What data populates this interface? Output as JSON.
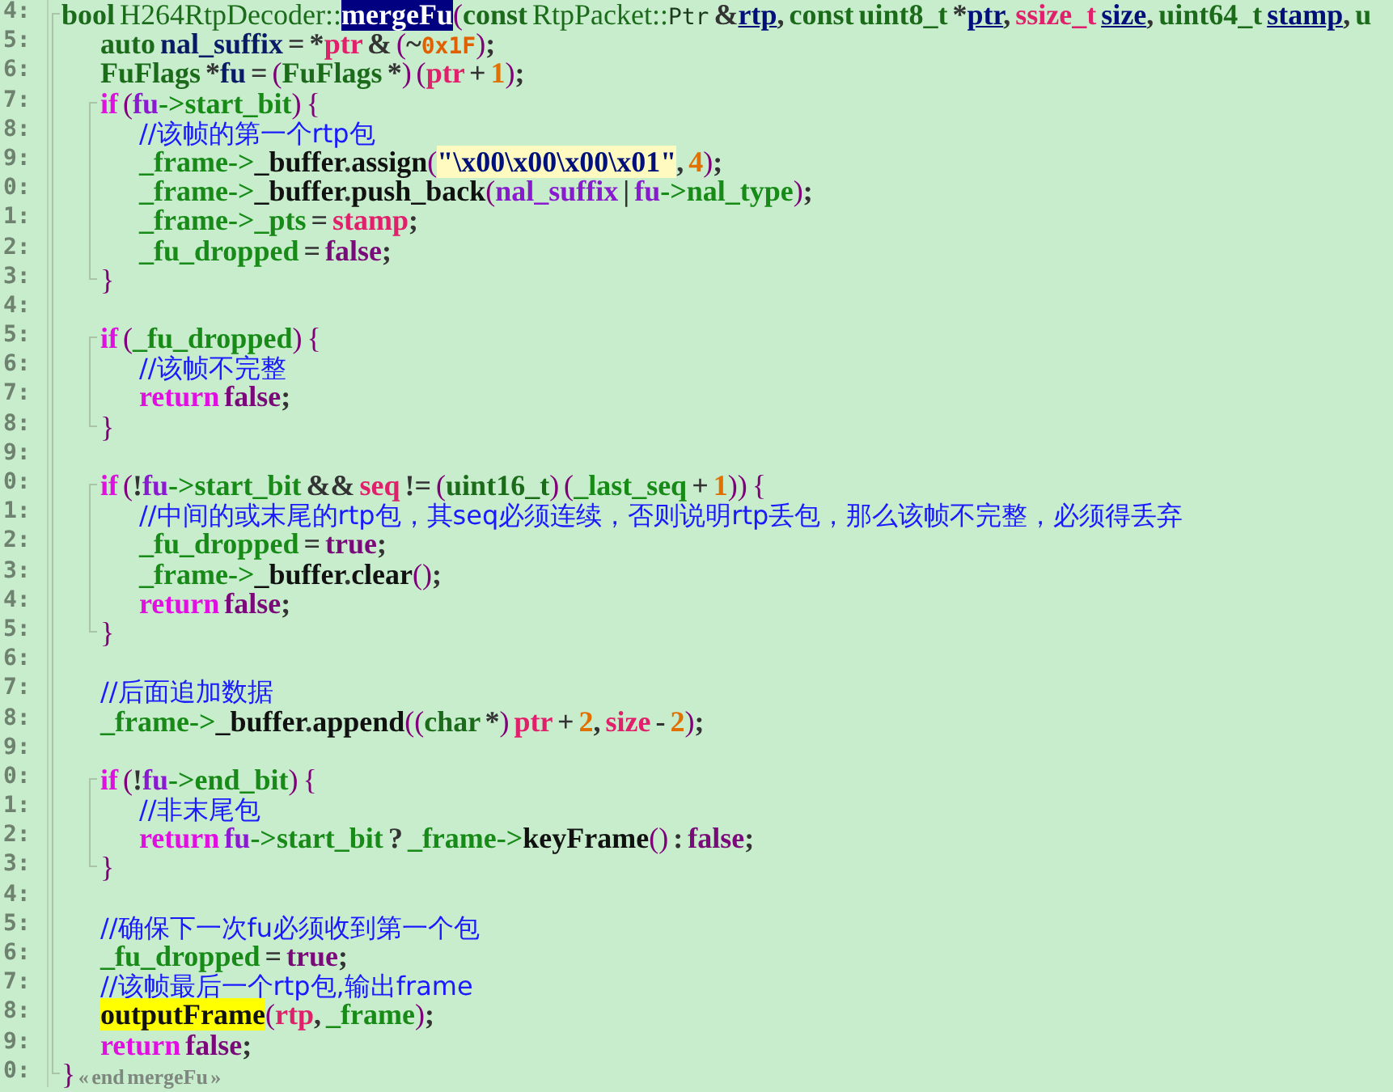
{
  "editor": {
    "lines": [
      {
        "number": "4:",
        "tokens": [
          {
            "kind": "type",
            "text": "bool"
          },
          {
            "kind": "scope",
            "text": " H264RtpDecoder::"
          },
          {
            "kind": "highlight",
            "text": "mergeFu"
          },
          {
            "kind": "punct",
            "text": "("
          },
          {
            "kind": "type",
            "text": "const"
          },
          {
            "kind": "scope",
            "text": " RtpPacket::"
          },
          {
            "kind": "mono",
            "text": "Ptr"
          },
          {
            "kind": "op",
            "text": " &"
          },
          {
            "kind": "param",
            "text": "rtp"
          },
          {
            "kind": "op",
            "text": ", "
          },
          {
            "kind": "type",
            "text": "const uint8_t"
          },
          {
            "kind": "op",
            "text": " *"
          },
          {
            "kind": "param",
            "text": "ptr"
          },
          {
            "kind": "op",
            "text": ", "
          },
          {
            "kind": "typedef",
            "text": "ssize_t "
          },
          {
            "kind": "param",
            "text": "size"
          },
          {
            "kind": "op",
            "text": ", "
          },
          {
            "kind": "type",
            "text": "uint64_t "
          },
          {
            "kind": "param",
            "text": "stamp"
          },
          {
            "kind": "op",
            "text": ", "
          },
          {
            "kind": "type",
            "text": "u"
          }
        ],
        "children": [
          {
            "number": "5:",
            "tokens": [
              {
                "kind": "type",
                "text": "auto"
              },
              {
                "kind": "local",
                "text": " nal_suffix"
              },
              {
                "kind": "op",
                "text": " = *"
              },
              {
                "kind": "arg",
                "text": "ptr"
              },
              {
                "kind": "op",
                "text": " & "
              },
              {
                "kind": "punct",
                "text": "("
              },
              {
                "kind": "op",
                "text": "~"
              },
              {
                "kind": "hex",
                "text": "0x1F"
              },
              {
                "kind": "punct",
                "text": ")"
              },
              {
                "kind": "op",
                "text": ";"
              }
            ]
          },
          {
            "number": "6:",
            "tokens": [
              {
                "kind": "type",
                "text": "FuFlags"
              },
              {
                "kind": "op",
                "text": " *"
              },
              {
                "kind": "local",
                "text": "fu"
              },
              {
                "kind": "op",
                "text": " = "
              },
              {
                "kind": "punct",
                "text": "("
              },
              {
                "kind": "type",
                "text": "FuFlags"
              },
              {
                "kind": "op",
                "text": " *"
              },
              {
                "kind": "punct",
                "text": ") ("
              },
              {
                "kind": "arg",
                "text": "ptr"
              },
              {
                "kind": "op",
                "text": " + "
              },
              {
                "kind": "num",
                "text": "1"
              },
              {
                "kind": "punct",
                "text": ")"
              },
              {
                "kind": "op",
                "text": ";"
              }
            ]
          },
          {
            "number": "7:",
            "tokens": [
              {
                "kind": "keyword",
                "text": "if"
              },
              {
                "kind": "punct",
                "text": " ("
              },
              {
                "kind": "var",
                "text": "fu"
              },
              {
                "kind": "member",
                "text": "->start_bit"
              },
              {
                "kind": "punct",
                "text": ") {"
              }
            ],
            "children": [
              {
                "number": "8:",
                "tokens": [
                  {
                    "kind": "comment",
                    "text": "//该帧的第一个rtp包"
                  }
                ]
              },
              {
                "number": "9:",
                "tokens": [
                  {
                    "kind": "member",
                    "text": "_frame->"
                  },
                  {
                    "kind": "method",
                    "text": "_buffer"
                  },
                  {
                    "kind": "op",
                    "text": "."
                  },
                  {
                    "kind": "method",
                    "text": "assign"
                  },
                  {
                    "kind": "punct",
                    "text": "("
                  },
                  {
                    "kind": "string",
                    "text": "\"\\x00\\x00\\x00\\x01\""
                  },
                  {
                    "kind": "op",
                    "text": ", "
                  },
                  {
                    "kind": "num",
                    "text": "4"
                  },
                  {
                    "kind": "punct",
                    "text": ")"
                  },
                  {
                    "kind": "op",
                    "text": ";"
                  }
                ]
              },
              {
                "number": "0:",
                "tokens": [
                  {
                    "kind": "member",
                    "text": "_frame->"
                  },
                  {
                    "kind": "method",
                    "text": "_buffer"
                  },
                  {
                    "kind": "op",
                    "text": "."
                  },
                  {
                    "kind": "method",
                    "text": "push_back"
                  },
                  {
                    "kind": "punct",
                    "text": "("
                  },
                  {
                    "kind": "var",
                    "text": "nal_suffix"
                  },
                  {
                    "kind": "op",
                    "text": " | "
                  },
                  {
                    "kind": "var",
                    "text": "fu"
                  },
                  {
                    "kind": "member",
                    "text": "->nal_type"
                  },
                  {
                    "kind": "punct",
                    "text": ")"
                  },
                  {
                    "kind": "op",
                    "text": ";"
                  }
                ]
              },
              {
                "number": "1:",
                "tokens": [
                  {
                    "kind": "member",
                    "text": "_frame->_pts"
                  },
                  {
                    "kind": "op",
                    "text": " = "
                  },
                  {
                    "kind": "arg",
                    "text": "stamp"
                  },
                  {
                    "kind": "op",
                    "text": ";"
                  }
                ]
              },
              {
                "number": "2:",
                "tokens": [
                  {
                    "kind": "member",
                    "text": "_fu_dropped"
                  },
                  {
                    "kind": "op",
                    "text": " = "
                  },
                  {
                    "kind": "bool",
                    "text": "false"
                  },
                  {
                    "kind": "op",
                    "text": ";"
                  }
                ]
              }
            ],
            "end": {
              "number": "3:",
              "tokens": [
                {
                  "kind": "punct",
                  "text": "}"
                }
              ]
            }
          },
          {
            "number": "4:"
          },
          {
            "number": "5:",
            "tokens": [
              {
                "kind": "keyword",
                "text": "if"
              },
              {
                "kind": "punct",
                "text": " ("
              },
              {
                "kind": "member",
                "text": "_fu_dropped"
              },
              {
                "kind": "punct",
                "text": ") {"
              }
            ],
            "children": [
              {
                "number": "6:",
                "tokens": [
                  {
                    "kind": "comment",
                    "text": "//该帧不完整"
                  }
                ]
              },
              {
                "number": "7:",
                "tokens": [
                  {
                    "kind": "keyword",
                    "text": "return"
                  },
                  {
                    "kind": "bool",
                    "text": " false"
                  },
                  {
                    "kind": "op",
                    "text": ";"
                  }
                ]
              }
            ],
            "end": {
              "number": "8:",
              "tokens": [
                {
                  "kind": "punct",
                  "text": "}"
                }
              ]
            }
          },
          {
            "number": "9:"
          },
          {
            "number": "0:",
            "tokens": [
              {
                "kind": "keyword",
                "text": "if"
              },
              {
                "kind": "punct",
                "text": " ("
              },
              {
                "kind": "op",
                "text": "!"
              },
              {
                "kind": "var",
                "text": "fu"
              },
              {
                "kind": "member",
                "text": "->start_bit"
              },
              {
                "kind": "op",
                "text": " && "
              },
              {
                "kind": "arg",
                "text": "seq"
              },
              {
                "kind": "op",
                "text": " != "
              },
              {
                "kind": "punct",
                "text": "("
              },
              {
                "kind": "type",
                "text": "uint16_t"
              },
              {
                "kind": "punct",
                "text": ") ("
              },
              {
                "kind": "member",
                "text": "_last_seq"
              },
              {
                "kind": "op",
                "text": " + "
              },
              {
                "kind": "num",
                "text": "1"
              },
              {
                "kind": "punct",
                "text": ")) {"
              }
            ],
            "children": [
              {
                "number": "1:",
                "tokens": [
                  {
                    "kind": "comment",
                    "text": "//中间的或末尾的rtp包，其seq必须连续，否则说明rtp丢包，那么该帧不完整，必须得丢弃"
                  }
                ]
              },
              {
                "number": "2:",
                "tokens": [
                  {
                    "kind": "member",
                    "text": "_fu_dropped"
                  },
                  {
                    "kind": "op",
                    "text": " = "
                  },
                  {
                    "kind": "bool",
                    "text": "true"
                  },
                  {
                    "kind": "op",
                    "text": ";"
                  }
                ]
              },
              {
                "number": "3:",
                "tokens": [
                  {
                    "kind": "member",
                    "text": "_frame->"
                  },
                  {
                    "kind": "method",
                    "text": "_buffer"
                  },
                  {
                    "kind": "op",
                    "text": "."
                  },
                  {
                    "kind": "method",
                    "text": "clear"
                  },
                  {
                    "kind": "punct",
                    "text": "()"
                  },
                  {
                    "kind": "op",
                    "text": ";"
                  }
                ]
              },
              {
                "number": "4:",
                "tokens": [
                  {
                    "kind": "keyword",
                    "text": "return"
                  },
                  {
                    "kind": "bool",
                    "text": " false"
                  },
                  {
                    "kind": "op",
                    "text": ";"
                  }
                ]
              }
            ],
            "end": {
              "number": "5:",
              "tokens": [
                {
                  "kind": "punct",
                  "text": "}"
                }
              ]
            }
          },
          {
            "number": "6:"
          },
          {
            "number": "7:",
            "tokens": [
              {
                "kind": "comment",
                "text": "//后面追加数据"
              }
            ]
          },
          {
            "number": "8:",
            "tokens": [
              {
                "kind": "member",
                "text": "_frame->"
              },
              {
                "kind": "method",
                "text": "_buffer"
              },
              {
                "kind": "op",
                "text": "."
              },
              {
                "kind": "method",
                "text": "append"
              },
              {
                "kind": "punct",
                "text": "(("
              },
              {
                "kind": "type",
                "text": "char"
              },
              {
                "kind": "op",
                "text": " *"
              },
              {
                "kind": "punct",
                "text": ")"
              },
              {
                "kind": "arg",
                "text": " ptr"
              },
              {
                "kind": "op",
                "text": " + "
              },
              {
                "kind": "num",
                "text": "2"
              },
              {
                "kind": "op",
                "text": ", "
              },
              {
                "kind": "arg",
                "text": "size"
              },
              {
                "kind": "op",
                "text": " - "
              },
              {
                "kind": "num",
                "text": "2"
              },
              {
                "kind": "punct",
                "text": ")"
              },
              {
                "kind": "op",
                "text": ";"
              }
            ]
          },
          {
            "number": "9:"
          },
          {
            "number": "0:",
            "tokens": [
              {
                "kind": "keyword",
                "text": "if"
              },
              {
                "kind": "punct",
                "text": " ("
              },
              {
                "kind": "op",
                "text": "!"
              },
              {
                "kind": "var",
                "text": "fu"
              },
              {
                "kind": "member",
                "text": "->end_bit"
              },
              {
                "kind": "punct",
                "text": ") {"
              }
            ],
            "children": [
              {
                "number": "1:",
                "tokens": [
                  {
                    "kind": "comment",
                    "text": "//非末尾包"
                  }
                ]
              },
              {
                "number": "2:",
                "tokens": [
                  {
                    "kind": "keyword",
                    "text": "return"
                  },
                  {
                    "kind": "var",
                    "text": " fu"
                  },
                  {
                    "kind": "member",
                    "text": "->start_bit"
                  },
                  {
                    "kind": "op",
                    "text": " ? "
                  },
                  {
                    "kind": "member",
                    "text": "_frame->"
                  },
                  {
                    "kind": "method",
                    "text": "keyFrame"
                  },
                  {
                    "kind": "punct",
                    "text": "()"
                  },
                  {
                    "kind": "op",
                    "text": " : "
                  },
                  {
                    "kind": "bool",
                    "text": "false"
                  },
                  {
                    "kind": "op",
                    "text": ";"
                  }
                ]
              }
            ],
            "end": {
              "number": "3:",
              "tokens": [
                {
                  "kind": "punct",
                  "text": "}"
                }
              ]
            }
          },
          {
            "number": "4:"
          },
          {
            "number": "5:",
            "tokens": [
              {
                "kind": "comment",
                "text": "//确保下一次fu必须收到第一个包"
              }
            ]
          },
          {
            "number": "6:",
            "tokens": [
              {
                "kind": "member",
                "text": "_fu_dropped"
              },
              {
                "kind": "op",
                "text": " = "
              },
              {
                "kind": "bool",
                "text": "true"
              },
              {
                "kind": "op",
                "text": ";"
              }
            ]
          },
          {
            "number": "7:",
            "tokens": [
              {
                "kind": "comment",
                "text": "//该帧最后一个rtp包,输出frame"
              }
            ]
          },
          {
            "number": "8:",
            "tokens": [
              {
                "kind": "call",
                "text": "outputFrame"
              },
              {
                "kind": "punct",
                "text": "("
              },
              {
                "kind": "arg",
                "text": "rtp"
              },
              {
                "kind": "op",
                "text": ", "
              },
              {
                "kind": "member",
                "text": "_frame"
              },
              {
                "kind": "punct",
                "text": ")"
              },
              {
                "kind": "op",
                "text": ";"
              }
            ]
          },
          {
            "number": "9:",
            "tokens": [
              {
                "kind": "keyword",
                "text": "return"
              },
              {
                "kind": "bool",
                "text": " false"
              },
              {
                "kind": "op",
                "text": ";"
              }
            ]
          }
        ],
        "end": {
          "number": "0:",
          "tokens": [
            {
              "kind": "punct",
              "text": "}"
            },
            {
              "kind": "endmark",
              "text": " « end mergeFu »"
            }
          ]
        }
      }
    ]
  }
}
